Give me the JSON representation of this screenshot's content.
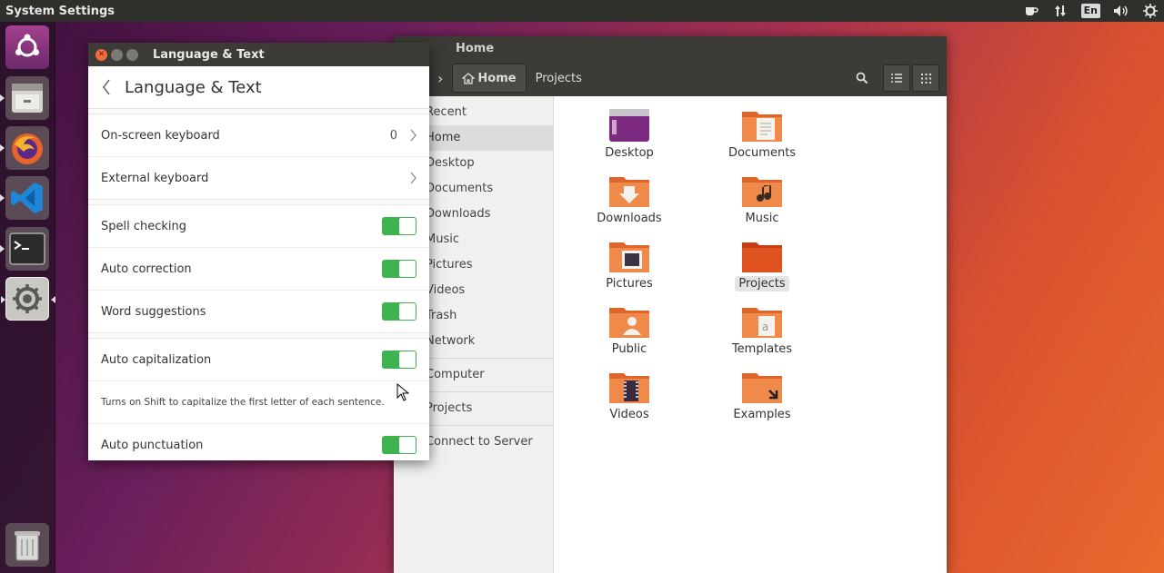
{
  "top_panel": {
    "app_title": "System Settings",
    "language_indicator": "En",
    "indicators": [
      "coffee-icon",
      "network-updown-icon",
      "keyboard-language-indicator",
      "volume-icon",
      "settings-gear-icon"
    ]
  },
  "launcher": {
    "items": [
      "ubuntu-logo-icon",
      "files-app-icon",
      "firefox-icon",
      "vscode-icon",
      "terminal-icon",
      "system-settings-icon",
      "trash-icon"
    ]
  },
  "files_window": {
    "title": "Home",
    "path": [
      "Home",
      "Projects"
    ],
    "sidebar": [
      "Recent",
      "Home",
      "Desktop",
      "Documents",
      "Downloads",
      "Music",
      "Pictures",
      "Videos",
      "Trash",
      "Network",
      "Computer",
      "Projects",
      "Connect to Server"
    ],
    "items": [
      {
        "label": "Desktop"
      },
      {
        "label": "Documents"
      },
      {
        "label": "Downloads"
      },
      {
        "label": "Music"
      },
      {
        "label": "Pictures"
      },
      {
        "label": "Projects"
      },
      {
        "label": "Public"
      },
      {
        "label": "Templates"
      },
      {
        "label": "Videos"
      },
      {
        "label": "Examples"
      }
    ]
  },
  "lt_window": {
    "title": "Language & Text",
    "heading": "Language & Text",
    "rows": {
      "onscreen_keyboard": {
        "label": "On-screen keyboard",
        "value": "0"
      },
      "external_keyboard": {
        "label": "External keyboard"
      },
      "spell_checking": {
        "label": "Spell checking",
        "on": true
      },
      "auto_correction": {
        "label": "Auto correction",
        "on": true
      },
      "word_suggestions": {
        "label": "Word suggestions",
        "on": true
      },
      "auto_capitalization": {
        "label": "Auto capitalization",
        "on": true
      },
      "auto_cap_note": "Turns on Shift to capitalize the first letter of each sentence.",
      "auto_punctuation": {
        "label": "Auto punctuation",
        "on": true
      }
    }
  },
  "colors": {
    "toggle_on": "#3eb34f",
    "close_button": "#f16b3e",
    "folder_orange": "#e0652b",
    "panel_bg": "#2f2f2c"
  }
}
